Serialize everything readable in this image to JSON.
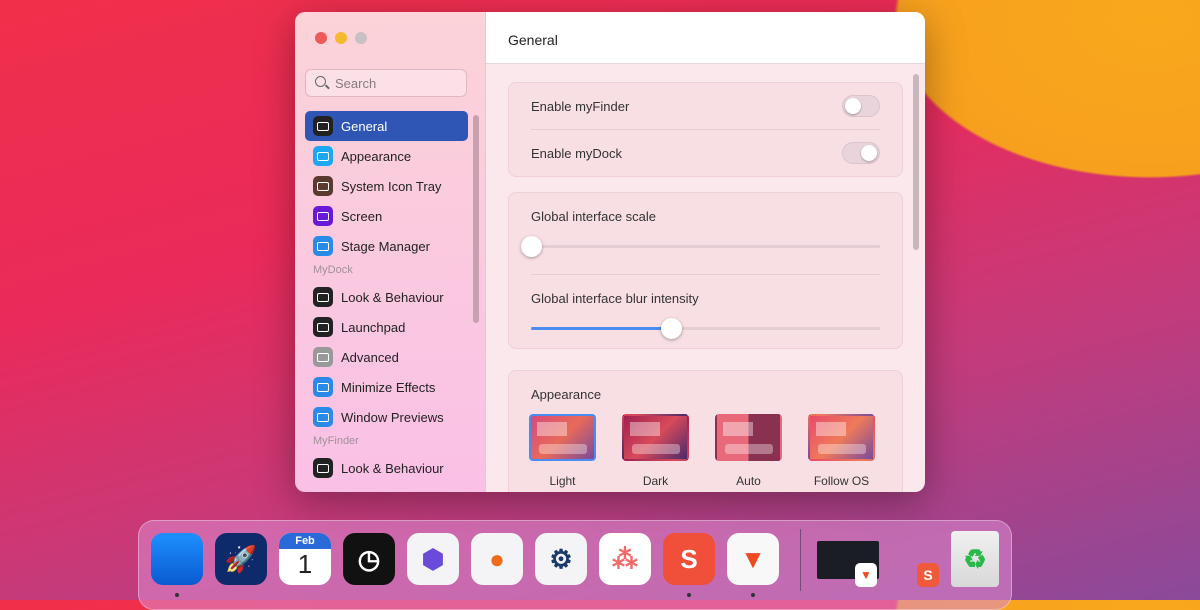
{
  "window": {
    "title": "General"
  },
  "sidebar": {
    "search_placeholder": "Search",
    "items": [
      {
        "label": "General",
        "icon": "general-icon",
        "color": "#222",
        "selected": true
      },
      {
        "label": "Appearance",
        "icon": "appearance-icon",
        "color": "#1aa8f0"
      },
      {
        "label": "System Icon Tray",
        "icon": "tray-icon",
        "color": "#5a3a2e"
      },
      {
        "label": "Screen",
        "icon": "screen-icon",
        "color": "#6a18d8"
      },
      {
        "label": "Stage Manager",
        "icon": "stage-manager-icon",
        "color": "#2a8ae8"
      }
    ],
    "section_mydock": "MyDock",
    "mydock_items": [
      {
        "label": "Look & Behaviour",
        "icon": "dock-icon",
        "color": "#222"
      },
      {
        "label": "Launchpad",
        "icon": "launchpad-icon",
        "color": "#222"
      },
      {
        "label": "Advanced",
        "icon": "advanced-icon",
        "color": "#999"
      },
      {
        "label": "Minimize Effects",
        "icon": "minimize-icon",
        "color": "#2a8ae8"
      },
      {
        "label": "Window Previews",
        "icon": "window-previews-icon",
        "color": "#2a8ae8"
      }
    ],
    "section_myfinder": "MyFinder",
    "myfinder_items": [
      {
        "label": "Look & Behaviour",
        "icon": "finder-icon",
        "color": "#222"
      }
    ]
  },
  "main": {
    "toggles": [
      {
        "label": "Enable myFinder",
        "on": false
      },
      {
        "label": "Enable myDock",
        "on": true
      }
    ],
    "sliders": [
      {
        "label": "Global interface scale",
        "value": 0
      },
      {
        "label": "Global interface blur intensity",
        "value": 40
      }
    ],
    "appearance": {
      "label": "Appearance",
      "options": [
        "Light",
        "Dark",
        "Auto",
        "Follow OS"
      ],
      "selected": "Light"
    }
  },
  "dock": {
    "apps": [
      {
        "name": "desktop",
        "running": true
      },
      {
        "name": "rocket"
      },
      {
        "name": "calendar",
        "month": "Feb",
        "day": "1"
      },
      {
        "name": "clock"
      },
      {
        "name": "obsidian"
      },
      {
        "name": "firefox"
      },
      {
        "name": "steam"
      },
      {
        "name": "asana"
      },
      {
        "name": "snagit",
        "running": true
      },
      {
        "name": "brave",
        "running": true
      }
    ],
    "recycle_bin": "recycle-bin-icon"
  }
}
